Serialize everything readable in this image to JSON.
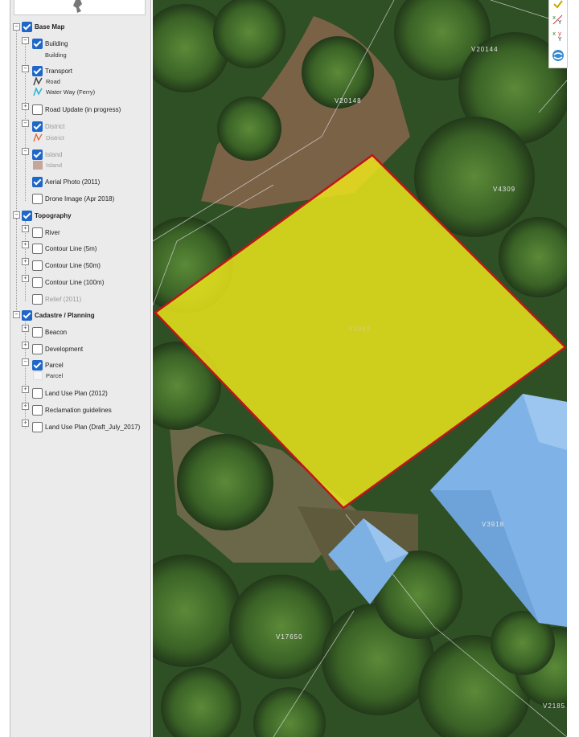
{
  "layer_panel": {
    "groups": [
      {
        "label": "Base Map",
        "checked": true
      },
      {
        "label": "Topography",
        "checked": true
      },
      {
        "label": "Cadastre / Planning",
        "checked": true
      }
    ],
    "layers": {
      "building": {
        "label": "Building",
        "checked": true,
        "legend": "Building"
      },
      "transport": {
        "label": "Transport",
        "checked": true,
        "legend": [
          "Road",
          "Water Way (Ferry)"
        ]
      },
      "road_update": {
        "label": "Road Update (in progress)",
        "checked": false
      },
      "district": {
        "label": "District",
        "checked": true,
        "legend": "District"
      },
      "island": {
        "label": "Island",
        "checked": true,
        "legend": "Island"
      },
      "aerial_photo": {
        "label": "Aerial Photo (2011)",
        "checked": true
      },
      "drone_image": {
        "label": "Drone Image (Apr 2018)",
        "checked": false
      },
      "river": {
        "label": "River",
        "checked": false
      },
      "contour_5m": {
        "label": "Contour Line (5m)",
        "checked": false
      },
      "contour_50m": {
        "label": "Contour Line (50m)",
        "checked": false
      },
      "contour_100m": {
        "label": "Contour Line (100m)",
        "checked": false
      },
      "relief": {
        "label": "Relief (2011)",
        "checked": false
      },
      "beacon": {
        "label": "Beacon",
        "checked": false
      },
      "development": {
        "label": "Development",
        "checked": false
      },
      "parcel": {
        "label": "Parcel",
        "checked": true,
        "legend": "Parcel"
      },
      "land_use_2012": {
        "label": "Land Use Plan (2012)",
        "checked": false
      },
      "reclamation": {
        "label": "Reclamation guidelines",
        "checked": false
      },
      "land_use_draft": {
        "label": "Land Use Plan (Draft_July_2017)",
        "checked": false
      }
    }
  },
  "map": {
    "parcel_labels": [
      "V20144",
      "V20148",
      "V4309",
      "V3993",
      "V3918",
      "V17650",
      "V2185"
    ],
    "highlight_color": "#f2ea1c",
    "highlight_stroke": "#c0141a"
  },
  "toolbar": {
    "icons": [
      "select-check-icon",
      "coordinate-xy-icon",
      "coordinate-xy-alt-icon",
      "globe-refresh-icon"
    ]
  },
  "colors": {
    "checkbox_blue": "#1e66c8",
    "panel_bg": "#ebebeb"
  }
}
